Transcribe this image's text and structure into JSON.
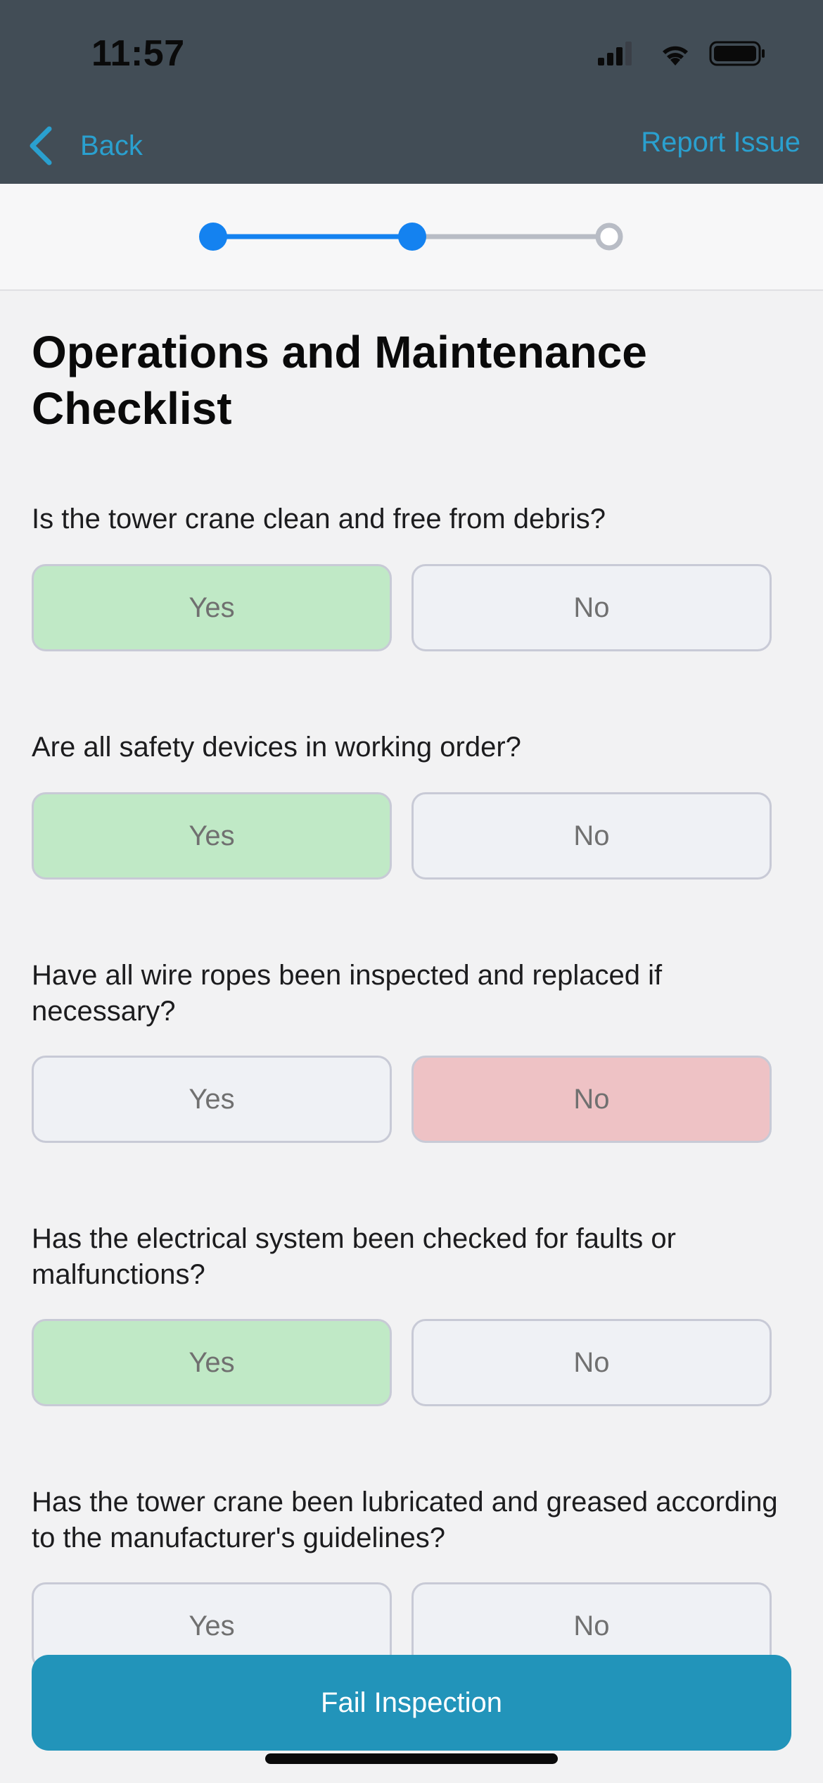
{
  "status_bar": {
    "time": "11:57"
  },
  "nav": {
    "back_label": "Back",
    "report_label": "Report Issue"
  },
  "stepper": {
    "total_steps": 3,
    "completed_steps": 2,
    "active_color": "#1482f0",
    "inactive_color": "#b8bcc5"
  },
  "page_title": "Operations and Maintenance Checklist",
  "questions": [
    {
      "text": "Is the tower crane clean and free from debris?",
      "yes": "Yes",
      "no": "No",
      "answer": "yes"
    },
    {
      "text": "Are all safety devices in working order?",
      "yes": "Yes",
      "no": "No",
      "answer": "yes"
    },
    {
      "text": "Have all wire ropes been inspected and replaced if necessary?",
      "yes": "Yes",
      "no": "No",
      "answer": "no"
    },
    {
      "text": "Has the electrical system been checked for faults or malfunctions?",
      "yes": "Yes",
      "no": "No",
      "answer": "yes"
    },
    {
      "text": "Has the tower crane been lubricated and greased according to the manufacturer's guidelines?",
      "yes": "Yes",
      "no": "No",
      "answer": null
    }
  ],
  "footer": {
    "fail_label": "Fail Inspection"
  },
  "colors": {
    "header_bg": "#424d56",
    "link": "#2aa0cf",
    "yes_selected": "#c0e9c6",
    "no_selected": "#eec2c5",
    "primary_button": "#2294ba"
  },
  "icons": {
    "back": "chevron-left-icon",
    "signal": "cellular-signal-icon",
    "wifi": "wifi-icon",
    "battery": "battery-icon"
  }
}
